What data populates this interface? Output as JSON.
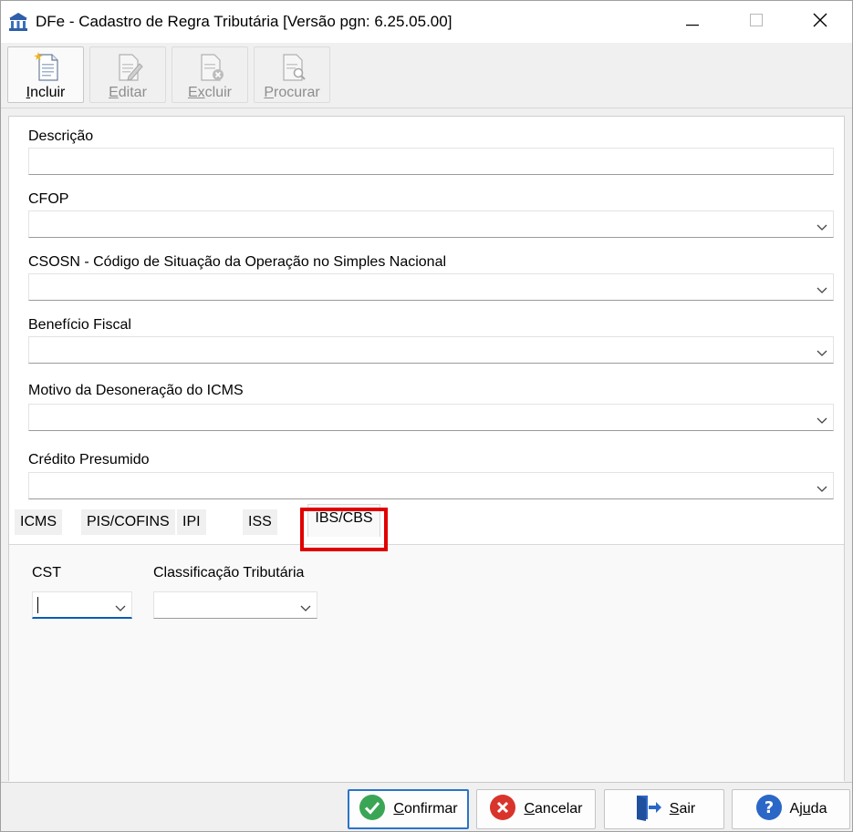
{
  "window": {
    "title": "DFe - Cadastro de Regra Tributária [Versão pgn: 6.25.05.00]"
  },
  "toolbar": {
    "buttons": [
      {
        "label_first": "I",
        "label_rest": "ncluir",
        "icon": "new-document-icon",
        "enabled": true
      },
      {
        "label_first": "E",
        "label_rest": "ditar",
        "icon": "edit-document-icon",
        "enabled": false
      },
      {
        "label_first": "Ex",
        "label_rest": "cluir",
        "icon": "delete-document-icon",
        "enabled": false
      },
      {
        "label_first": "P",
        "label_rest": "rocurar",
        "icon": "search-document-icon",
        "enabled": false
      }
    ]
  },
  "form": {
    "descricao": {
      "label": "Descrição",
      "value": ""
    },
    "cfop": {
      "label": "CFOP",
      "value": ""
    },
    "csosn": {
      "label": "CSOSN - Código de Situação da Operação no Simples Nacional",
      "value": ""
    },
    "beneficio": {
      "label": "Benefício Fiscal",
      "value": ""
    },
    "motivo": {
      "label": "Motivo da Desoneração do ICMS",
      "value": ""
    },
    "credito": {
      "label": "Crédito Presumido",
      "value": ""
    }
  },
  "tabs": {
    "items": [
      "ICMS",
      "PIS/COFINS",
      "IPI",
      "ISS",
      "IBS/CBS"
    ],
    "selected": "IBS/CBS"
  },
  "ibs_cbs": {
    "cst_label": "CST",
    "cst_value": "",
    "classificacao_label": "Classificação Tributária",
    "classificacao_value": ""
  },
  "footer": {
    "confirmar": {
      "first": "C",
      "rest": "onfirmar"
    },
    "cancelar": {
      "first": "C",
      "rest": "ancelar"
    },
    "sair": {
      "first": "S",
      "rest": "air"
    },
    "ajuda": {
      "pre": "Aj",
      "first": "u",
      "rest": "da"
    }
  },
  "colors": {
    "highlight": "#e00000",
    "focus": "#0a5cb5",
    "confirm_green": "#3aa655",
    "cancel_red": "#d9342b",
    "help_blue": "#2b67c6"
  }
}
